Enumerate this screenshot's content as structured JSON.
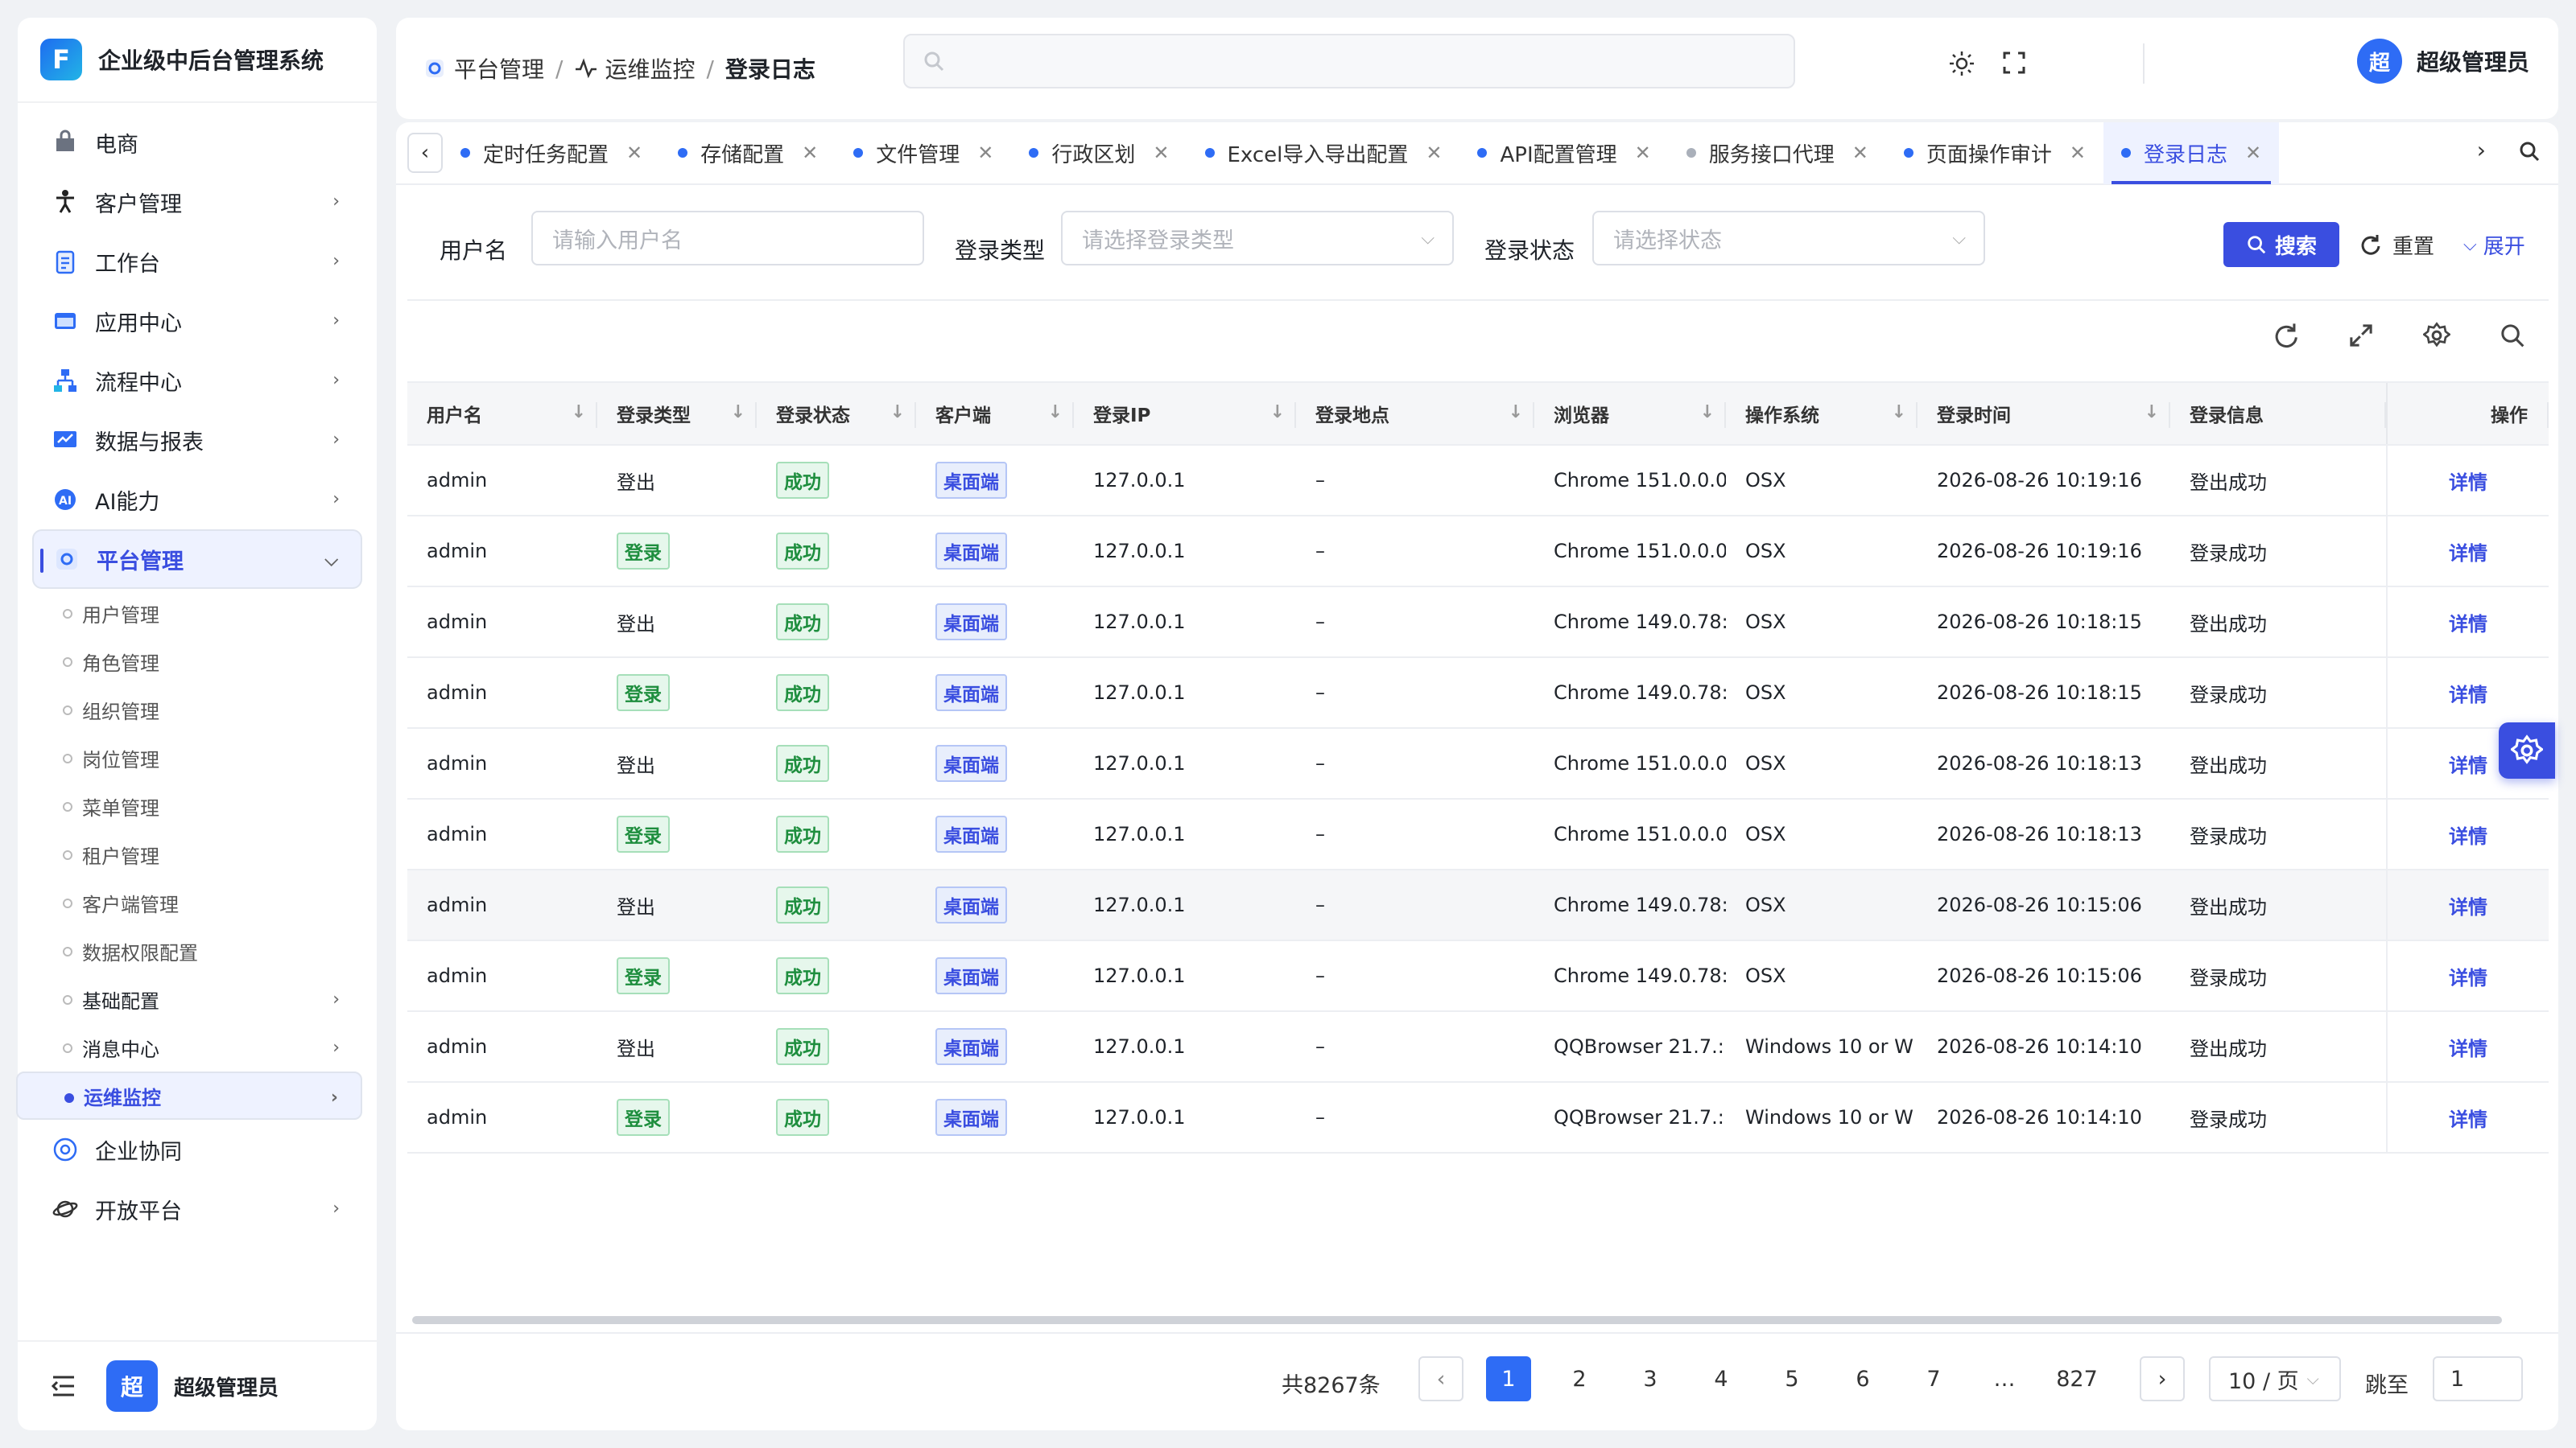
{
  "app": {
    "title": "企业级中后台管理系统",
    "logo_letter": "F"
  },
  "sidebar": {
    "items": [
      {
        "label": "电商",
        "icon": "bag-icon",
        "has_children": false
      },
      {
        "label": "客户管理",
        "icon": "person-icon",
        "has_children": true
      },
      {
        "label": "工作台",
        "icon": "clipboard-icon",
        "has_children": true
      },
      {
        "label": "应用中心",
        "icon": "app-window-icon",
        "has_children": true
      },
      {
        "label": "流程中心",
        "icon": "flow-icon",
        "has_children": true
      },
      {
        "label": "数据与报表",
        "icon": "report-icon",
        "has_children": true
      },
      {
        "label": "AI能力",
        "icon": "ai-icon",
        "has_children": true
      },
      {
        "label": "平台管理",
        "icon": "platform-gear-icon",
        "has_children": true,
        "expanded": true
      }
    ],
    "sub_items": [
      {
        "label": "用户管理"
      },
      {
        "label": "角色管理"
      },
      {
        "label": "组织管理"
      },
      {
        "label": "岗位管理"
      },
      {
        "label": "菜单管理"
      },
      {
        "label": "租户管理"
      },
      {
        "label": "客户端管理"
      },
      {
        "label": "数据权限配置"
      },
      {
        "label": "基础配置",
        "has_children": true
      },
      {
        "label": "消息中心",
        "has_children": true
      },
      {
        "label": "运维监控",
        "has_children": true,
        "active": true
      }
    ],
    "bottom_items": [
      {
        "label": "企业协同",
        "icon": "collab-icon"
      },
      {
        "label": "开放平台",
        "icon": "planet-icon",
        "has_children": true
      }
    ],
    "footer": {
      "avatar": "超",
      "name": "超级管理员"
    }
  },
  "header": {
    "breadcrumb": [
      "平台管理",
      "运维监控",
      "登录日志"
    ],
    "search_placeholder": "",
    "user": {
      "avatar": "超",
      "name": "超级管理员"
    }
  },
  "tabs": [
    {
      "label": "定时任务配置",
      "dot": "blue"
    },
    {
      "label": "存储配置",
      "dot": "blue"
    },
    {
      "label": "文件管理",
      "dot": "blue"
    },
    {
      "label": "行政区划",
      "dot": "blue"
    },
    {
      "label": "Excel导入导出配置",
      "dot": "blue"
    },
    {
      "label": "API配置管理",
      "dot": "blue"
    },
    {
      "label": "服务接口代理",
      "dot": "grey"
    },
    {
      "label": "页面操作审计",
      "dot": "blue"
    },
    {
      "label": "登录日志",
      "dot": "blue",
      "active": true
    }
  ],
  "filters": {
    "username_label": "用户名",
    "username_placeholder": "请输入用户名",
    "login_type_label": "登录类型",
    "login_type_placeholder": "请选择登录类型",
    "login_status_label": "登录状态",
    "login_status_placeholder": "请选择状态",
    "search_btn": "搜索",
    "reset_btn": "重置",
    "expand_btn": "展开"
  },
  "table": {
    "columns": [
      "用户名",
      "登录类型",
      "登录状态",
      "客户端",
      "登录IP",
      "登录地点",
      "浏览器",
      "操作系统",
      "登录时间",
      "登录信息",
      "操作"
    ],
    "rows": [
      {
        "user": "admin",
        "type": "登出",
        "type_tag": false,
        "status": "成功",
        "client": "桌面端",
        "ip": "127.0.0.1",
        "location": "–",
        "browser": "Chrome 151.0.0.0",
        "os": "OSX",
        "time": "2026-08-26 10:19:16",
        "info": "登出成功",
        "action": "详情"
      },
      {
        "user": "admin",
        "type": "登录",
        "type_tag": true,
        "status": "成功",
        "client": "桌面端",
        "ip": "127.0.0.1",
        "location": "–",
        "browser": "Chrome 151.0.0.0",
        "os": "OSX",
        "time": "2026-08-26 10:19:16",
        "info": "登录成功",
        "action": "详情"
      },
      {
        "user": "admin",
        "type": "登出",
        "type_tag": false,
        "status": "成功",
        "client": "桌面端",
        "ip": "127.0.0.1",
        "location": "–",
        "browser": "Chrome 149.0.78:",
        "os": "OSX",
        "time": "2026-08-26 10:18:15",
        "info": "登出成功",
        "action": "详情"
      },
      {
        "user": "admin",
        "type": "登录",
        "type_tag": true,
        "status": "成功",
        "client": "桌面端",
        "ip": "127.0.0.1",
        "location": "–",
        "browser": "Chrome 149.0.78:",
        "os": "OSX",
        "time": "2026-08-26 10:18:15",
        "info": "登录成功",
        "action": "详情"
      },
      {
        "user": "admin",
        "type": "登出",
        "type_tag": false,
        "status": "成功",
        "client": "桌面端",
        "ip": "127.0.0.1",
        "location": "–",
        "browser": "Chrome 151.0.0.0",
        "os": "OSX",
        "time": "2026-08-26 10:18:13",
        "info": "登出成功",
        "action": "详情"
      },
      {
        "user": "admin",
        "type": "登录",
        "type_tag": true,
        "status": "成功",
        "client": "桌面端",
        "ip": "127.0.0.1",
        "location": "–",
        "browser": "Chrome 151.0.0.0",
        "os": "OSX",
        "time": "2026-08-26 10:18:13",
        "info": "登录成功",
        "action": "详情"
      },
      {
        "user": "admin",
        "type": "登出",
        "type_tag": false,
        "status": "成功",
        "client": "桌面端",
        "ip": "127.0.0.1",
        "location": "–",
        "browser": "Chrome 149.0.78:",
        "os": "OSX",
        "time": "2026-08-26 10:15:06",
        "info": "登出成功",
        "action": "详情",
        "hover": true
      },
      {
        "user": "admin",
        "type": "登录",
        "type_tag": true,
        "status": "成功",
        "client": "桌面端",
        "ip": "127.0.0.1",
        "location": "–",
        "browser": "Chrome 149.0.78:",
        "os": "OSX",
        "time": "2026-08-26 10:15:06",
        "info": "登录成功",
        "action": "详情"
      },
      {
        "user": "admin",
        "type": "登出",
        "type_tag": false,
        "status": "成功",
        "client": "桌面端",
        "ip": "127.0.0.1",
        "location": "–",
        "browser": "QQBrowser 21.7.:",
        "os": "Windows 10 or W",
        "time": "2026-08-26 10:14:10",
        "info": "登出成功",
        "action": "详情"
      },
      {
        "user": "admin",
        "type": "登录",
        "type_tag": true,
        "status": "成功",
        "client": "桌面端",
        "ip": "127.0.0.1",
        "location": "–",
        "browser": "QQBrowser 21.7.:",
        "os": "Windows 10 or W",
        "time": "2026-08-26 10:14:10",
        "info": "登录成功",
        "action": "详情"
      }
    ]
  },
  "pagination": {
    "total": "共8267条",
    "pages": [
      "1",
      "2",
      "3",
      "4",
      "5",
      "6",
      "7",
      "…",
      "827"
    ],
    "current": "1",
    "page_size": "10 / 页",
    "jump_label": "跳至",
    "jump_value": "1"
  },
  "colors": {
    "accent": "#3a4ee0",
    "brand_blue": "#2e6cf5",
    "success": "#1e8e3e"
  }
}
